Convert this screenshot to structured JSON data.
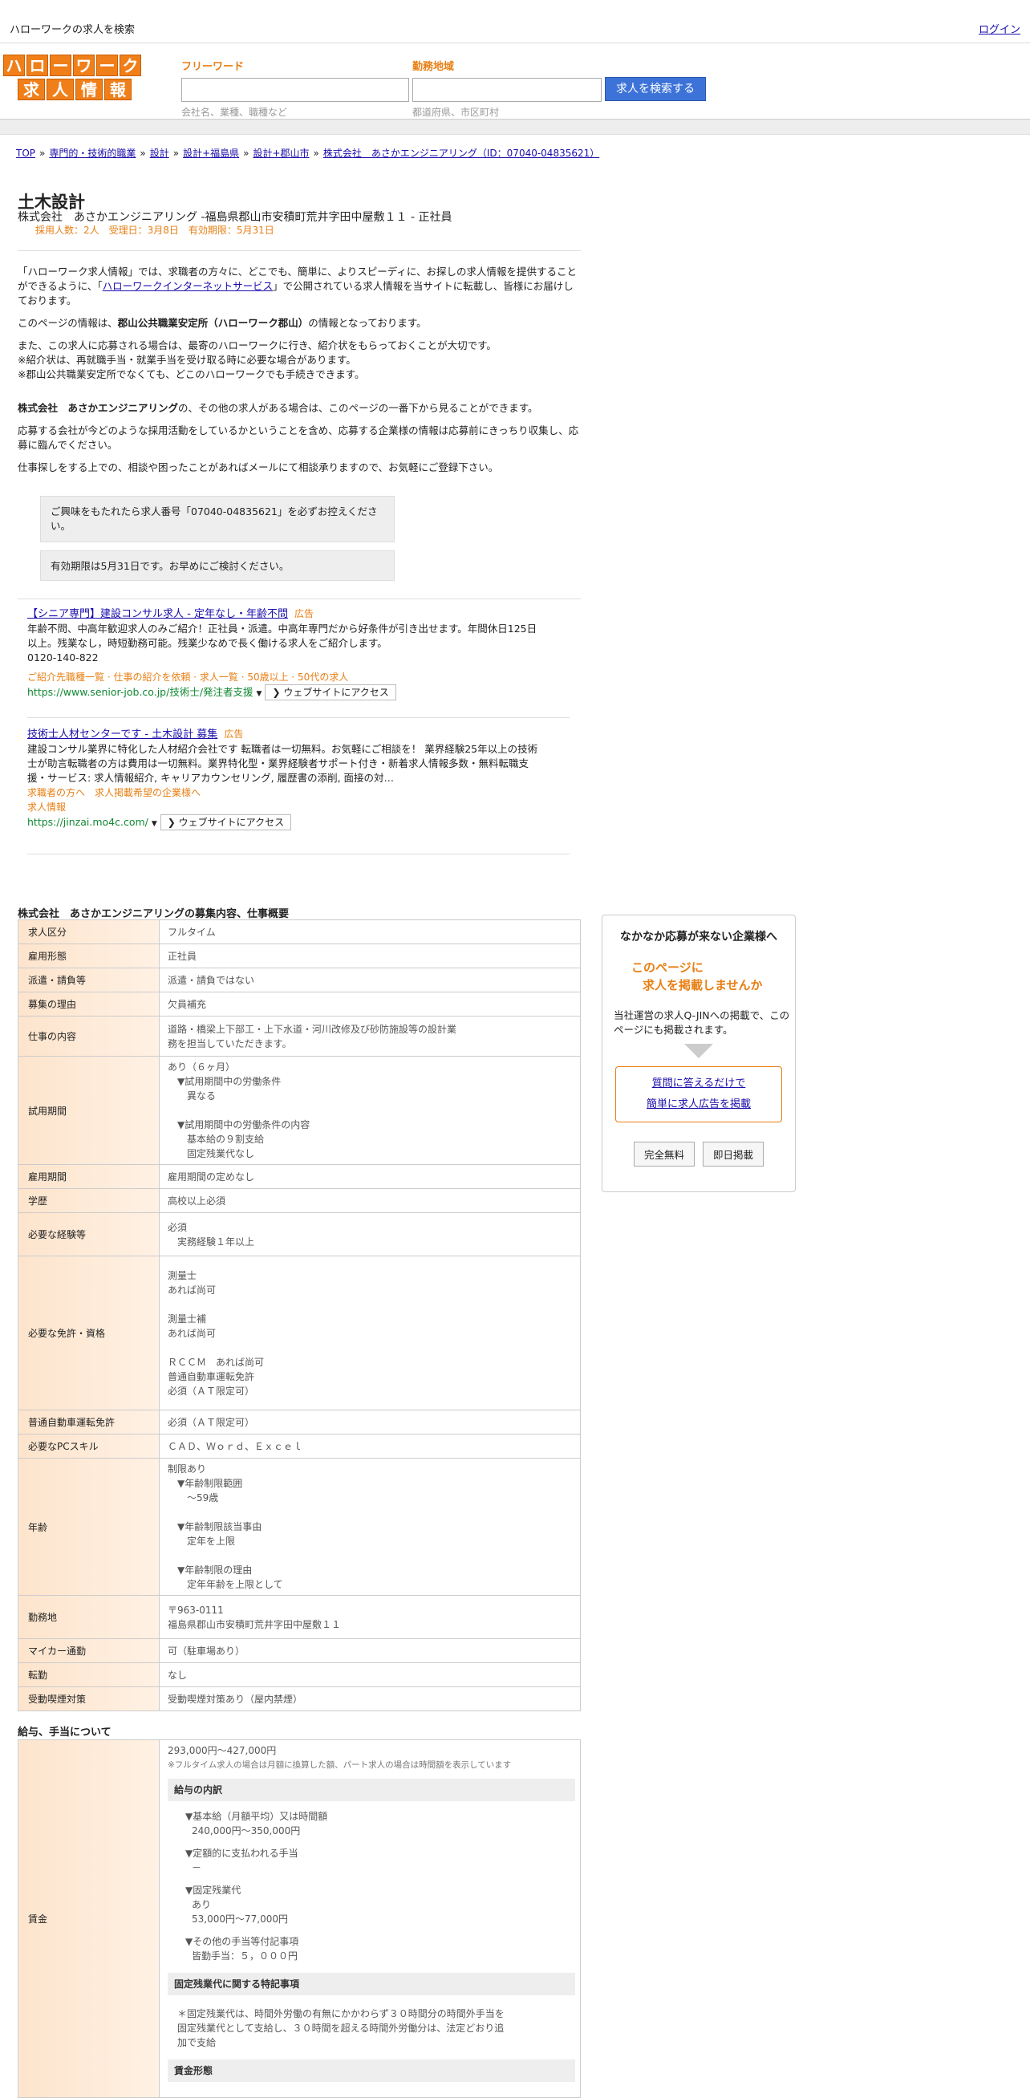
{
  "topbar": {
    "title": "ハローワークの求人を検索",
    "login": "ログイン"
  },
  "logo": {
    "row1": [
      "ハ",
      "ロ",
      "ー",
      "ワ",
      "ー",
      "ク"
    ],
    "row2": [
      "求",
      "人",
      "情",
      "報"
    ]
  },
  "search": {
    "keyword_label": "フリーワード",
    "keyword_hint": "会社名、業種、職種など",
    "area_label": "勤務地域",
    "area_hint": "都道府県、市区町村",
    "button": "求人を検索する"
  },
  "breadcrumb": [
    "TOP",
    "専門的・技術的職業",
    "設計",
    "設計+福島県",
    "設計+郡山市",
    "株式会社　あさかエンジニアリング（ID：07040-04835621）"
  ],
  "job": {
    "title": "土木設計",
    "company_line": "株式会社　あさかエンジニアリング -福島県郡山市安積町荒井字田中屋敷１１ - 正社員",
    "meta": "採用人数：2人　受理日：3月8日　有効期限：5月31日"
  },
  "intro": {
    "p1_a": "「ハローワーク求人情報」では、求職者の方々に、どこでも、簡単に、よりスピーディに、お探しの求人情報を提供することができるように、「",
    "p1_link": "ハローワークインターネットサービス",
    "p1_b": "」で公開されている求人情報を当サイトに転載し、皆様にお届けしております。",
    "p2_a": "このページの情報は、",
    "p2_bold": "郡山公共職業安定所（ハローワーク郡山）",
    "p2_b": "の情報となっております。",
    "p3_1": "また、この求人に応募される場合は、最寄のハローワークに行き、紹介状をもらっておくことが大切です。",
    "p3_2": "※紹介状は、再就職手当・就業手当を受け取る時に必要な場合があります。",
    "p3_3": "※郡山公共職業安定所でなくても、どこのハローワークでも手続きできます。",
    "p4_bold": "株式会社　あさかエンジニアリング",
    "p4_rest": "の、その他の求人がある場合は、このページの一番下から見ることができます。",
    "p5": "応募する会社が今どのような採用活動をしているかということを含め、応募する企業様の情報は応募前にきっちり収集し、応募に臨んでください。",
    "p6": "仕事探しをする上での、相談や困ったことがあればメールにて相談承りますので、お気軽にご登録下さい。"
  },
  "notes": {
    "n1": "ご興味をもたれたら求人番号「07040-04835621」を必ずお控えください。",
    "n2": "有効期限は5月31日です。お早めにご検討ください。"
  },
  "ads": [
    {
      "title": "【シニア専門】建設コンサル求人 - 定年なし・年齢不問",
      "badge": "広告",
      "desc": "年齢不問、中高年歓迎求人のみご紹介！正社員・派遣。中高年専門だから好条件が引き出せます。年間休日125日以上。残業なし，時短勤務可能。残業少なめで長く働ける求人をご紹介します。",
      "phone": "0120-140-822",
      "sublinks": "ご紹介先職種一覧 · 仕事の紹介を依頼 · 求人一覧 · 50歳以上 · 50代の求人",
      "url": "https://www.senior-job.co.jp/技術士/発注者支援",
      "cta": "❯ ウェブサイトにアクセス"
    },
    {
      "title": "技術士人材センターです - 土木設計 募集",
      "badge": "広告",
      "desc": "建設コンサル業界に特化した人材紹介会社です 転職者は一切無料。お気軽にご相談を！ 業界経験25年以上の技術士が助言転職者の方は費用は一切無料。業界特化型・業界経験者サポート付き・新着求人情報多数・無料転職支援・サービス: 求人情報紹介, キャリアカウンセリング, 履歴書の添削, 面接の対…",
      "sublinks": "求職者の方へ　求人掲載希望の企業様へ",
      "sublinks2": "求人情報",
      "url": "https://jinzai.mo4c.com/",
      "cta": "❯ ウェブサイトにアクセス"
    }
  ],
  "section_title": "株式会社　あさかエンジニアリングの募集内容、仕事概要",
  "rows": [
    {
      "label": "求人区分",
      "value": "フルタイム"
    },
    {
      "label": "雇用形態",
      "value": "正社員"
    },
    {
      "label": "派遣・請負等",
      "value": "派遣・請負ではない"
    },
    {
      "label": "募集の理由",
      "value": "欠員補充"
    },
    {
      "label": "仕事の内容",
      "value": "道路・橋梁上下部工・上下水道・河川改修及び砂防施設等の設計業\n務を担当していただきます。"
    },
    {
      "label": "試用期間",
      "value": "あり（６ヶ月）\n　▼試用期間中の労働条件\n　　異なる\n\n　▼試用期間中の労働条件の内容\n　　基本給の９割支給\n　　固定残業代なし"
    },
    {
      "label": "雇用期間",
      "value": "雇用期間の定めなし"
    },
    {
      "label": "学歴",
      "value": "高校以上必須"
    },
    {
      "label": "必要な経験等",
      "value": "必須\n　実務経験１年以上"
    },
    {
      "label": "必要な免許・資格",
      "value": "測量士\nあれば尚可\n\n測量士補\nあれば尚可\n\nＲＣＣＭ　あれば尚可\n普通自動車運転免許\n必須（ＡＴ限定可）"
    },
    {
      "label": "普通自動車運転免許",
      "value": "必須（ＡＴ限定可）"
    },
    {
      "label": "必要なPCスキル",
      "value": "ＣＡＤ、Ｗｏｒｄ、Ｅｘｃｅｌ"
    },
    {
      "label": "年齢",
      "value": "制限あり\n　▼年齢制限範囲\n　　〜59歳\n\n　▼年齢制限該当事由\n　　定年を上限\n\n　▼年齢制限の理由\n　　定年年齢を上限として"
    },
    {
      "label": "勤務地",
      "value": "〒963-0111\n福島県郡山市安積町荒井字田中屋敷１１"
    },
    {
      "label": "マイカー通勤",
      "value": "可（駐車場あり）"
    },
    {
      "label": "転勤",
      "value": "なし"
    },
    {
      "label": "受動喫煙対策",
      "value": "受動喫煙対策あり（屋内禁煙）"
    }
  ],
  "salary": {
    "heading": "給与、手当について",
    "label": "賃金",
    "range": "293,000円〜427,000円",
    "note": "※フルタイム求人の場合は月額に換算した額、パート求人の場合は時間額を表示しています",
    "breakdown_title": "給与の内訳",
    "base_label": "▼基本給（月額平均）又は時間額",
    "base_value": "240,000円〜350,000円",
    "fixed_allow_label": "▼定額的に支払われる手当",
    "fixed_allow_value": "－",
    "overtime_label": "▼固定残業代",
    "overtime_value1": "あり",
    "overtime_value2": "53,000円〜77,000円",
    "other_label": "▼その他の手当等付記事項",
    "other_value": "皆勤手当：５，０００円",
    "special_title": "固定残業代に関する特記事項",
    "special_text": "＊固定残業代は、時間外労働の有無にかかわらず３０時間分の時間外手当を固定残業代として支給し、３０時間を超える時間外労働分は、法定どおり追加で支給",
    "next_title": "賃金形態"
  },
  "side": {
    "title": "なかなか応募が来ない企業様へ",
    "catch1": "このページに",
    "catch2": "求人を掲載しませんか",
    "desc": "当社運営の求人Q-JINへの掲載で、このページにも掲載されます。",
    "link1": "質問に答えるだけで",
    "link2": "簡単に求人広告を掲載",
    "btn1": "完全無料",
    "btn2": "即日掲載"
  }
}
